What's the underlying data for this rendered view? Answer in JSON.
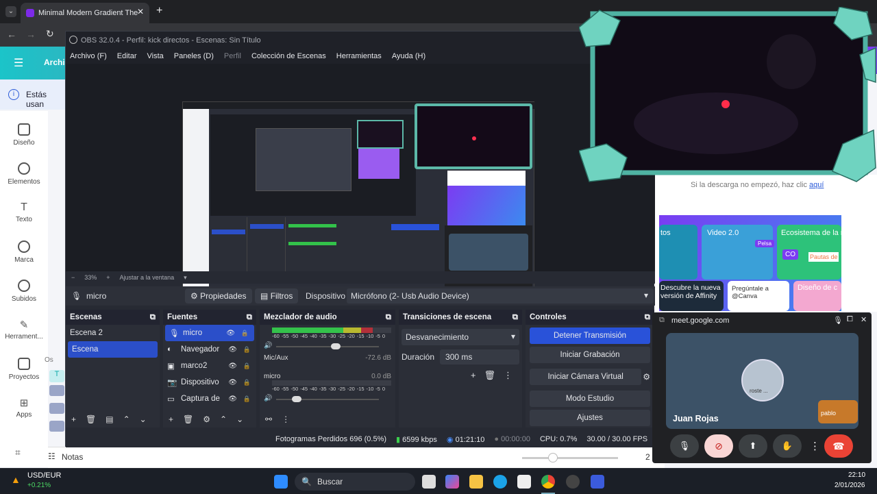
{
  "browser": {
    "tab_title": "Minimal Modern Gradient The",
    "new_tab": "+",
    "menu": "⋮"
  },
  "canva": {
    "header_title": "Archi",
    "notice": "Estás usan",
    "sidebar": [
      {
        "label": "Diseño"
      },
      {
        "label": "Elementos"
      },
      {
        "label": "Texto"
      },
      {
        "label": "Marca"
      },
      {
        "label": "Subidos"
      },
      {
        "label": "Herrament..."
      },
      {
        "label": "Proyectos"
      },
      {
        "label": "Apps"
      }
    ],
    "notes_label": "Notas",
    "os_text": "Os",
    "zoom_right": "2",
    "download_text": "Si la descarga no empezó, haz clic",
    "download_link": "aquí",
    "banner": {
      "tiles": [
        "tos",
        "Video 2.0",
        "Ecosistema de la m",
        "Descubre la nueva versión de Affinity",
        "Pregúntale a @Canva",
        "Diseño de c"
      ],
      "badges": [
        "Pelsa",
        "Pautas de la m",
        "CO"
      ]
    }
  },
  "obs": {
    "title": "OBS 32.0.4 - Perfil: kick directos - Escenas: Sin Título",
    "menu": [
      {
        "label": "Archivo (F)"
      },
      {
        "label": "Editar"
      },
      {
        "label": "Vista"
      },
      {
        "label": "Paneles (D)"
      },
      {
        "label": "Perfil",
        "dim": true
      },
      {
        "label": "Colección de Escenas"
      },
      {
        "label": "Herramientas"
      },
      {
        "label": "Ayuda (H)"
      }
    ],
    "zoom": "33%",
    "fit": "Ajustar a la ventana",
    "source_bar": {
      "name": "micro",
      "properties": "Propiedades",
      "filters": "Filtros",
      "device_label": "Dispositivo",
      "device_value": "Micrófono (2- Usb Audio Device)"
    },
    "scenes": {
      "title": "Escenas",
      "items": [
        "Escena 2",
        "Escena"
      ],
      "selected": 1
    },
    "sources": {
      "title": "Fuentes",
      "items": [
        "micro",
        "Navegador",
        "marco2",
        "Dispositivo",
        "Captura de"
      ]
    },
    "mixer": {
      "title": "Mezclador de audio",
      "ticks": [
        "-60",
        "-55",
        "-50",
        "-45",
        "-40",
        "-35",
        "-30",
        "-25",
        "-20",
        "-15",
        "-10",
        "-5",
        "0"
      ],
      "channels": [
        {
          "name": "Mic/Aux",
          "db": "-72.6 dB",
          "level": 0.85,
          "fader": 0.58
        },
        {
          "name": "micro",
          "db": "0.0 dB",
          "level": 0.0,
          "fader": 0.2
        }
      ]
    },
    "transitions": {
      "title": "Transiciones de escena",
      "type": "Desvanecimiento",
      "duration_label": "Duración",
      "duration": "300 ms"
    },
    "controls": {
      "title": "Controles",
      "buttons": [
        "Detener Transmisión",
        "Iniciar Grabación",
        "Iniciar Cámara Virtual",
        "Modo Estudio",
        "Ajustes"
      ]
    },
    "status": {
      "dropped": "Fotogramas Perdidos 696 (0.5%)",
      "bitrate": "6599 kbps",
      "live_time": "01:21:10",
      "rec_time": "00:00:00",
      "cpu": "CPU: 0.7%",
      "fps": "30.00 / 30.00 FPS"
    }
  },
  "meet": {
    "url": "meet.google.com",
    "name": "Juan Rojas",
    "avatar_text": "roste ...",
    "other": "pablo"
  },
  "taskbar": {
    "ticker": "USD/EUR",
    "change": "+0.21%",
    "search": "Buscar",
    "time": "22:10",
    "date": "2/01/2026"
  },
  "colors": {
    "obs_accent": "#2b4fc9",
    "canva_teal": "#1bc4c9",
    "meet_red": "#ea4335",
    "meet_tile": "#3c5267",
    "ticker_green": "#4cd964"
  }
}
